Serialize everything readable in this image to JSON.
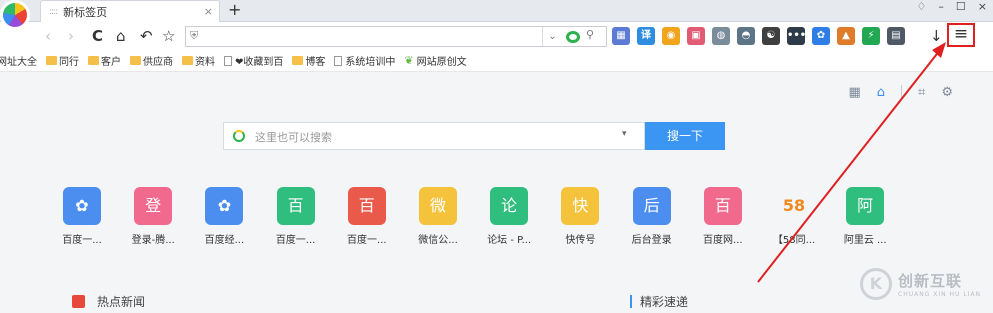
{
  "tab": {
    "title": "新标签页",
    "fav": "::::",
    "close": "×",
    "new": "+"
  },
  "window": {
    "skin": "♢",
    "min": "–",
    "max": "☐",
    "close": "×"
  },
  "nav": {
    "back": "‹",
    "forward": "›",
    "reload": "C",
    "home": "⌂",
    "undo": "↶",
    "star": "☆",
    "download": "↓",
    "menu": "≡",
    "addr_dd": "⌄",
    "search_icon": "⚲",
    "shield": "⛨"
  },
  "extensions": [
    {
      "name": "grid-extension",
      "glyph": "▦",
      "color": "#5b7bd5"
    },
    {
      "name": "translate-extension",
      "glyph": "译",
      "color": "#2e8de0"
    },
    {
      "name": "shield-extension",
      "glyph": "◉",
      "color": "#f1a51c"
    },
    {
      "name": "red-extension",
      "glyph": "▣",
      "color": "#e25b74"
    },
    {
      "name": "globe-extension",
      "glyph": "◍",
      "color": "#7a8b9a"
    },
    {
      "name": "screenshot-extension",
      "glyph": "◓",
      "color": "#5e7487"
    },
    {
      "name": "yinyang-extension",
      "glyph": "☯",
      "color": "#3f3f3f"
    },
    {
      "name": "dots-extension",
      "glyph": "•••",
      "color": "#2e3b4a"
    },
    {
      "name": "paw-extension",
      "glyph": "✿",
      "color": "#2f7ee6"
    },
    {
      "name": "fox-extension",
      "glyph": "▲",
      "color": "#e07b2a"
    },
    {
      "name": "bolt-extension",
      "glyph": "⚡",
      "color": "#22a852"
    },
    {
      "name": "table-extension",
      "glyph": "▤",
      "color": "#4d5a66"
    }
  ],
  "bookmarks": [
    {
      "label": "网址大全",
      "type": "page"
    },
    {
      "label": "同行",
      "type": "folder"
    },
    {
      "label": "客户",
      "type": "folder"
    },
    {
      "label": "供应商",
      "type": "folder"
    },
    {
      "label": "资料",
      "type": "folder"
    },
    {
      "label": "❤收藏到百",
      "type": "page"
    },
    {
      "label": "博客",
      "type": "folder"
    },
    {
      "label": "系统培训中",
      "type": "page"
    },
    {
      "label": "网站原创文",
      "type": "leaf"
    }
  ],
  "toolrow": {
    "grid": "▦",
    "home": "⌂",
    "skin": "⌗",
    "settings": "⚙"
  },
  "search": {
    "placeholder": "这里也可以搜索",
    "dd": "▾",
    "button": "搜一下"
  },
  "apps": [
    {
      "label": "百度一...",
      "glyph": "✿",
      "color": "#4c8df0"
    },
    {
      "label": "登录-腾...",
      "glyph": "登",
      "color": "#f2698e"
    },
    {
      "label": "百度经...",
      "glyph": "✿",
      "color": "#4c8df0"
    },
    {
      "label": "百度一...",
      "glyph": "百",
      "color": "#2fbe7e"
    },
    {
      "label": "百度一...",
      "glyph": "百",
      "color": "#ea5a4a"
    },
    {
      "label": "微信公...",
      "glyph": "微",
      "color": "#f5c23b"
    },
    {
      "label": "论坛 - P...",
      "glyph": "论",
      "color": "#2fbe7e"
    },
    {
      "label": "快传号",
      "glyph": "快",
      "color": "#f5c23b"
    },
    {
      "label": "后台登录",
      "glyph": "后",
      "color": "#4c8df0"
    },
    {
      "label": "百度网...",
      "glyph": "百",
      "color": "#f2698e"
    },
    {
      "label": "【58同...",
      "glyph": "58",
      "color": "#f4f5f7"
    },
    {
      "label": "阿里云 ...",
      "glyph": "阿",
      "color": "#2fbe7e"
    }
  ],
  "sections": {
    "hot": "热点新闻",
    "jc": "精彩速递"
  },
  "watermark": {
    "mark": "K",
    "t1": "创新互联",
    "t2": "CHUANG XIN HU LIAN"
  }
}
